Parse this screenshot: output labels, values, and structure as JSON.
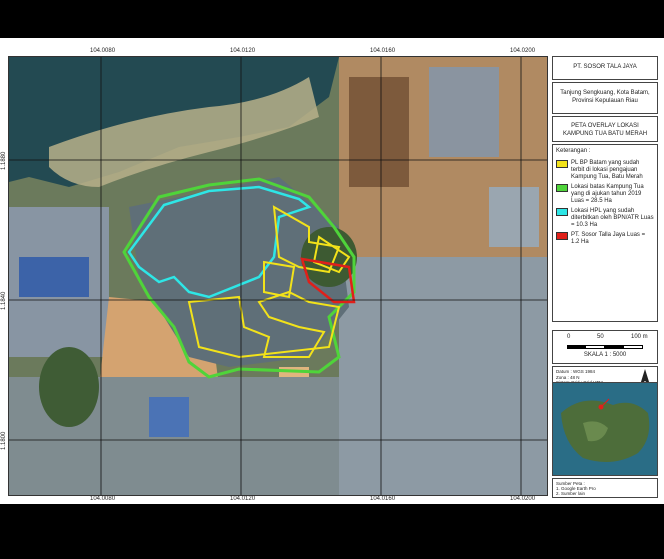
{
  "map": {
    "grid_labels": {
      "top": [
        "104.0080",
        "104.0120",
        "104.0160",
        "104.0200"
      ],
      "bottom": [
        "104.0080",
        "104.0120",
        "104.0160",
        "104.0200"
      ],
      "left": [
        "1.1880",
        "1.1840",
        "1.1800"
      ]
    },
    "overlays": [
      {
        "name": "Lokasi batas Kampung Tua",
        "color": "#4fd43a"
      },
      {
        "name": "Lokasi HPL",
        "color": "#2ee6e6"
      },
      {
        "name": "PL BP Batam",
        "color": "#f2e21a"
      },
      {
        "name": "PT. Sosor Talla Jaya",
        "color": "#e0201a"
      }
    ]
  },
  "panel": {
    "company": "PT. SOSOR TALA JAYA",
    "location": "Tanjung Sengkuang, Kota Batam, Provinsi Kepulauan Riau",
    "title": "PETA OVERLAY LOKASI KAMPUNG TUA BATU MERAH",
    "legend_header": "Keterangan :",
    "legend": [
      {
        "label": "PL BP Batam yang sudah terbit di lokasi pengajuan Kampung Tua, Batu Merah",
        "color": "#f2e21a"
      },
      {
        "label": "Lokasi batas Kampung Tua yang di ajukan tahun 2019 Luas = 28.5 Ha",
        "color": "#4fd43a"
      },
      {
        "label": "Lokasi HPL yang sudah diterbitkan oleh BPN/ATR Luas = 10.3 Ha",
        "color": "#2ee6e6"
      },
      {
        "label": "PT. Sosor Talla Jaya Luas = 1.2 Ha",
        "color": "#e0201a"
      }
    ],
    "scale": {
      "ticks": [
        "0",
        "50",
        "100 m"
      ],
      "text": "SKALA 1 : 5000"
    },
    "info_lines": [
      "Datum : WGS 1984",
      "Zona : 48 N",
      "Sistem Grid : Grid UTM",
      "Proyeksi : Universal Transverse Mercator"
    ],
    "sources_lines": [
      "Sumber Peta :",
      "1. Google Earth Pro",
      "2. Sumber lain"
    ]
  }
}
